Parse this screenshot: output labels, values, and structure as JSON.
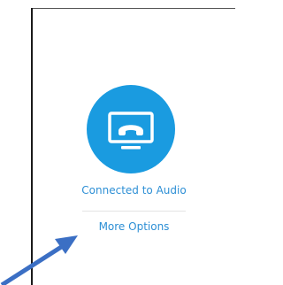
{
  "audio": {
    "icon": "phone-monitor-icon",
    "status_label": "Connected to Audio",
    "more_options_label": "More Options"
  },
  "colors": {
    "accent": "#1a9be0",
    "link_text": "#2d8fd5",
    "annotation_arrow": "#3b6fc4"
  }
}
